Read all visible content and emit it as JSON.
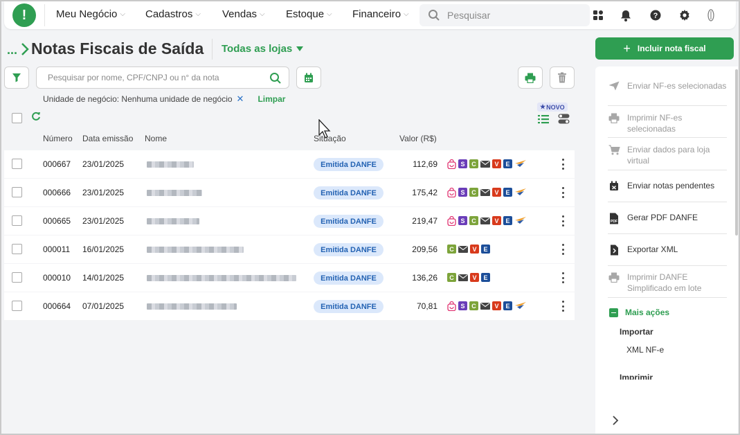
{
  "nav": {
    "logo": "!",
    "items": [
      "Meu Negócio",
      "Cadastros",
      "Vendas",
      "Estoque",
      "Financeiro"
    ],
    "search_placeholder": "Pesquisar"
  },
  "page": {
    "breadcrumb_dots": "...",
    "title": "Notas Fiscais de Saída",
    "store_selector": "Todas as lojas",
    "include_button": "Incluir nota fiscal"
  },
  "filters": {
    "search_placeholder": "Pesquisar por nome, CPF/CNPJ ou n° da nota",
    "chip_label": "Unidade de negócio: Nenhuma unidade de negócio",
    "chip_remove": "✕",
    "clear_label": "Limpar",
    "novo_badge": "NOVO"
  },
  "table": {
    "headers": {
      "number": "Número",
      "date": "Data emissão",
      "name": "Nome",
      "status": "Situação",
      "value": "Valor (R$)"
    },
    "rows": [
      {
        "number": "000667",
        "date": "23/01/2025",
        "status": "Emitida DANFE",
        "value": "112,69",
        "icons": [
          "bag",
          "S",
          "C",
          "mail",
          "V",
          "E",
          "tc"
        ]
      },
      {
        "number": "000666",
        "date": "23/01/2025",
        "status": "Emitida DANFE",
        "value": "175,42",
        "icons": [
          "bag",
          "S",
          "C",
          "mail",
          "V",
          "E",
          "tc"
        ]
      },
      {
        "number": "000665",
        "date": "23/01/2025",
        "status": "Emitida DANFE",
        "value": "219,47",
        "icons": [
          "bag",
          "S",
          "C",
          "mail",
          "V",
          "E",
          "tc"
        ]
      },
      {
        "number": "000011",
        "date": "16/01/2025",
        "status": "Emitida DANFE",
        "value": "209,56",
        "icons": [
          "C",
          "mail",
          "V",
          "E"
        ]
      },
      {
        "number": "000010",
        "date": "14/01/2025",
        "status": "Emitida DANFE",
        "value": "136,26",
        "icons": [
          "C",
          "mail",
          "V",
          "E"
        ]
      },
      {
        "number": "000664",
        "date": "07/01/2025",
        "status": "Emitida DANFE",
        "value": "70,81",
        "icons": [
          "bag",
          "S",
          "C",
          "mail",
          "V",
          "E",
          "tc"
        ]
      }
    ]
  },
  "side_panel": {
    "actions": [
      {
        "label": "Enviar NF-es selecionadas",
        "icon": "send-icon",
        "enabled": false
      },
      {
        "label": "Imprimir NF-es selecionadas",
        "icon": "printer-icon",
        "enabled": false
      },
      {
        "label": "Enviar dados para loja virtual",
        "icon": "cart-icon",
        "enabled": false
      },
      {
        "label": "Enviar notas pendentes",
        "icon": "calendar-x-icon",
        "enabled": true
      },
      {
        "label": "Gerar PDF DANFE",
        "icon": "pdf-icon",
        "enabled": true
      },
      {
        "label": "Exportar XML",
        "icon": "export-file-icon",
        "enabled": true
      },
      {
        "label": "Imprimir DANFE Simplificado em lote",
        "icon": "printer-icon",
        "enabled": false
      }
    ],
    "more_actions": "Mais ações",
    "import_heading": "Importar",
    "import_item": "XML NF-e",
    "print_heading": "Imprimir"
  },
  "colors": {
    "brand": "#2f9e52",
    "badge_bg": "#dbe8fb",
    "badge_text": "#2463b3"
  }
}
